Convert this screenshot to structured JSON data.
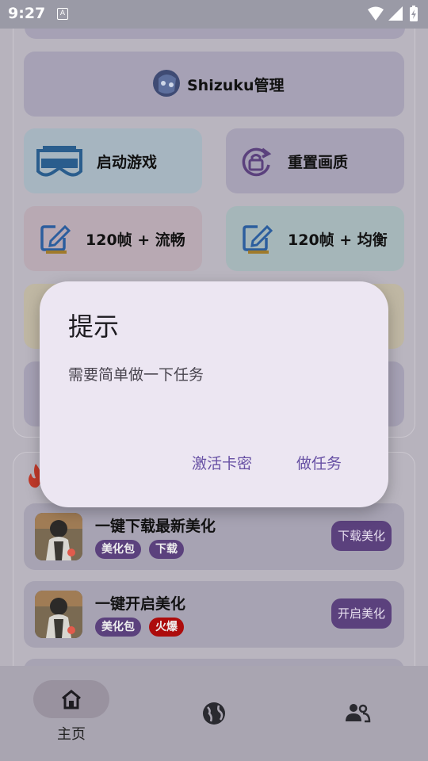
{
  "status_bar": {
    "time": "9:27",
    "notification_icon": "A"
  },
  "tools": {
    "shizuku": "Shizuku管理",
    "launch_game": "启动游戏",
    "reset_quality": "重置画质",
    "fps_smooth": "120帧 + 流畅",
    "fps_balanced": "120帧 + 均衡"
  },
  "tasks": [
    {
      "title": "一键下载最新美化",
      "tag1": "美化包",
      "tag2": "下载",
      "button": "下载美化"
    },
    {
      "title": "一键开启美化",
      "tag1": "美化包",
      "tag2": "火爆",
      "button": "开启美化"
    }
  ],
  "nav": {
    "home_label": "主页"
  },
  "dialog": {
    "title": "提示",
    "message": "需要简单做一下任务",
    "activate_label": "激活卡密",
    "task_label": "做任务"
  },
  "colors": {
    "accent": "#6750a4",
    "dialog_bg": "#ece6f2",
    "tag_purple": "#5b417d",
    "tag_hot": "#ad0c0c"
  }
}
